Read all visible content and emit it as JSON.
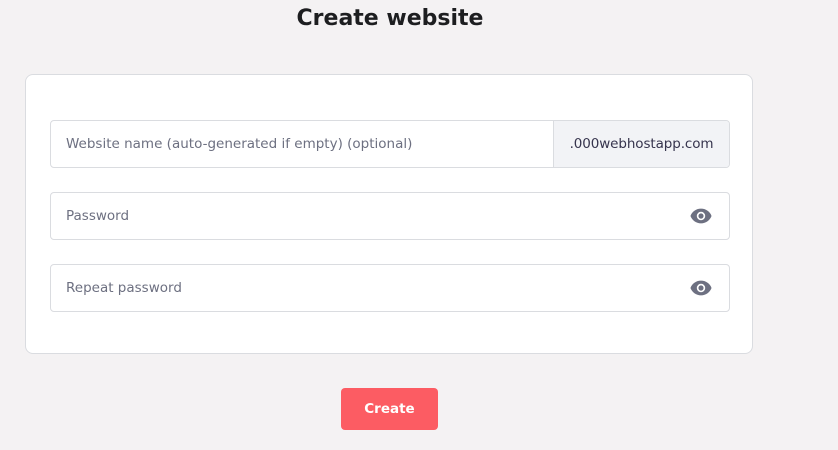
{
  "page": {
    "title": "Create website"
  },
  "form": {
    "website_name": {
      "placeholder": "Website name (auto-generated if empty) (optional)",
      "value": "",
      "suffix": ".000webhostapp.com"
    },
    "password": {
      "placeholder": "Password",
      "value": "",
      "toggle_icon": "eye-icon"
    },
    "repeat_password": {
      "placeholder": "Repeat password",
      "value": "",
      "toggle_icon": "eye-icon"
    },
    "submit_label": "Create"
  },
  "colors": {
    "background": "#f4f2f3",
    "primary_button": "#fc5c63",
    "suffix_background": "#f2f3f6",
    "icon": "#6d7081"
  }
}
